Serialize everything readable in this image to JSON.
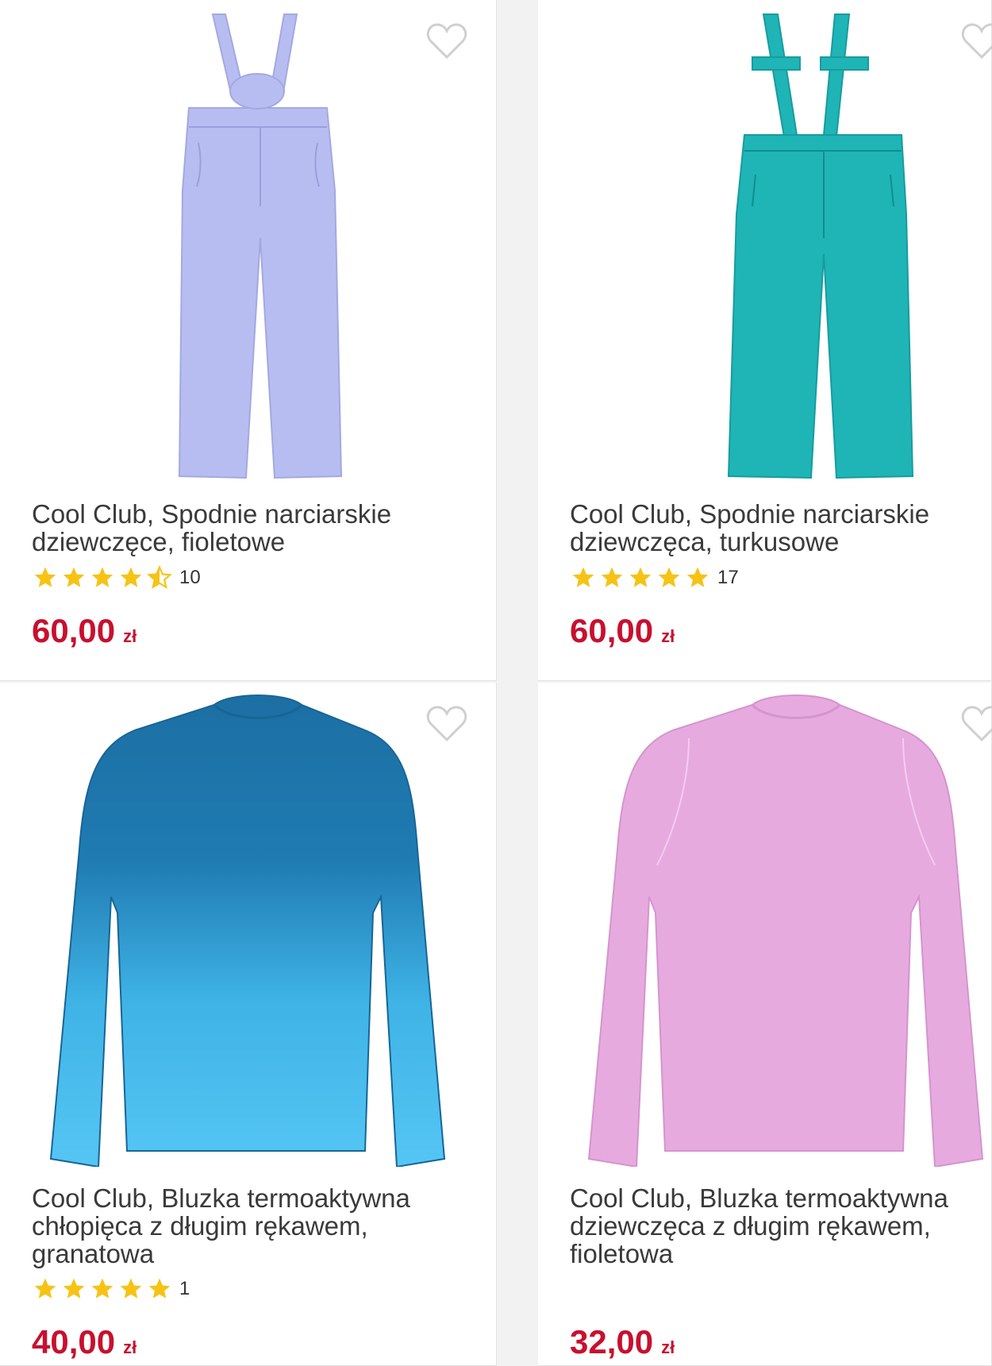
{
  "products": [
    {
      "title": "Cool Club, Spodnie narciarskie\ndziewczęce, fioletowe",
      "rating": 4.5,
      "rating_count": "10",
      "price": "60,00",
      "currency": "zł",
      "color": "#b7bdf0"
    },
    {
      "title": "Cool Club, Spodnie narciarskie\ndziewczęca, turkusowe",
      "rating": 5,
      "rating_count": "17",
      "price": "60,00",
      "currency": "zł",
      "color": "#1fb4b6"
    },
    {
      "title": "Cool Club, Bluzka termoaktywna\nchłopięca z długim rękawem,\ngranatowa",
      "rating": 5,
      "rating_count": "1",
      "price": "40,00",
      "currency": "zł",
      "color": "#1c6fa3"
    },
    {
      "title": "Cool Club, Bluzka termoaktywna\ndziewczęca z długim rękawem,\nfioletowa",
      "price": "32,00",
      "currency": "zł",
      "color": "#e6aadf"
    }
  ],
  "icons": {
    "favorite": "heart-outline-icon",
    "star": "star-icon"
  },
  "colors": {
    "price": "#c8102e",
    "star": "#f6c315",
    "heart": "#cfcfcf"
  }
}
